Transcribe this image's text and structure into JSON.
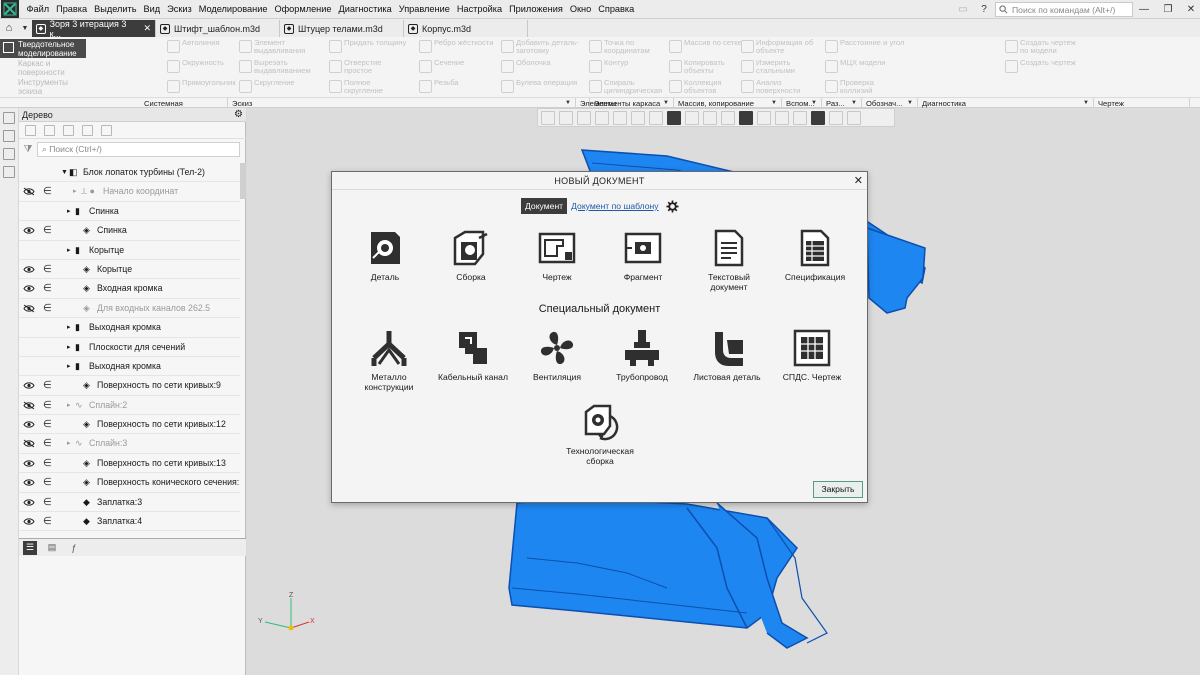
{
  "menu": [
    "Файл",
    "Правка",
    "Выделить",
    "Вид",
    "Эскиз",
    "Моделирование",
    "Оформление",
    "Диагностика",
    "Управление",
    "Настройка",
    "Приложения",
    "Окно",
    "Справка"
  ],
  "search": {
    "placeholder": "Поиск по командам (Alt+/)"
  },
  "tabs": [
    {
      "label": "Зоря 3 итерация 3 к...",
      "active": true
    },
    {
      "label": "Штифт_шаблон.m3d",
      "active": false
    },
    {
      "label": "Штуцер телами.m3d",
      "active": false
    },
    {
      "label": "Корпус.m3d",
      "active": false
    }
  ],
  "ribbon": {
    "modes": [
      "Твердотельное моделирование",
      "Каркас и поверхности",
      "Инструменты эскиза"
    ],
    "tools": [
      "Автолиния",
      "Элемент выдавливания",
      "Придать толщину",
      "Ребро жёсткости",
      "Добавить деталь-заготовку",
      "Точка по координатам",
      "Массив по сетке",
      "Информация об объекте",
      "Расстояние и угол",
      "Создать чертеж по модели",
      "Окружность",
      "Вырезать выдавливанием",
      "Отверстие простое",
      "Сечение",
      "Оболочка",
      "Контур",
      "Копировать объекты",
      "Измерить стальными",
      "МЦХ модели",
      "Создать чертеж",
      "Прямоугольник",
      "Скругление",
      "Полное скругление",
      "Резьба",
      "Булева операция",
      "Спираль цилиндрическая",
      "Коллекция объектов",
      "Анализ поверхности",
      "Проверка коллизий"
    ],
    "groups": [
      {
        "label": "Системная"
      },
      {
        "label": "Эскиз"
      },
      {
        "label": "Элементы тела"
      },
      {
        "label": "Элементы каркаса"
      },
      {
        "label": "Массив, копирование"
      },
      {
        "label": "Вспом..."
      },
      {
        "label": "Раз..."
      },
      {
        "label": "Обознач..."
      },
      {
        "label": "Диагностика"
      },
      {
        "label": "Чертеж"
      }
    ]
  },
  "tree": {
    "title": "Дерево",
    "search_placeholder": "Поиск (Ctrl+/)",
    "rows": [
      {
        "label": "Блок лопаток турбины (Тел-2)",
        "eye": "none",
        "muted": false
      },
      {
        "label": "Начало координат",
        "eye": "hidden",
        "muted": true
      },
      {
        "label": "Спинка",
        "eye": "none",
        "muted": false
      },
      {
        "label": "Спинка",
        "eye": "visible",
        "muted": false
      },
      {
        "label": "Корытце",
        "eye": "none",
        "muted": false
      },
      {
        "label": "Корытце",
        "eye": "visible",
        "muted": false
      },
      {
        "label": "Входная кромка",
        "eye": "visible",
        "muted": false
      },
      {
        "label": "Для входных каналов 262.5",
        "eye": "hidden",
        "muted": true
      },
      {
        "label": "Выходная кромка",
        "eye": "none",
        "muted": false
      },
      {
        "label": "Плоскости для сечений",
        "eye": "none",
        "muted": false
      },
      {
        "label": "Выходная кромка",
        "eye": "none",
        "muted": false
      },
      {
        "label": "Поверхность по сети кривых:9",
        "eye": "visible",
        "muted": false
      },
      {
        "label": "Сплайн:2",
        "eye": "hidden",
        "muted": true
      },
      {
        "label": "Поверхность по сети кривых:12",
        "eye": "visible",
        "muted": false
      },
      {
        "label": "Сплайн:3",
        "eye": "hidden",
        "muted": true
      },
      {
        "label": "Поверхность по сети кривых:13",
        "eye": "visible",
        "muted": false
      },
      {
        "label": "Поверхность конического сечения:",
        "eye": "visible",
        "muted": false
      },
      {
        "label": "Заплатка:3",
        "eye": "visible",
        "muted": false
      },
      {
        "label": "Заплатка:4",
        "eye": "visible",
        "muted": false
      }
    ]
  },
  "dialog": {
    "title": "НОВЫЙ ДОКУМЕНТ",
    "tab_document": "Документ",
    "tab_template": "Документ по шаблону",
    "section_special": "Специальный документ",
    "close_label": "Закрыть",
    "documents": [
      {
        "label": "Деталь",
        "icon": "part-icon"
      },
      {
        "label": "Сборка",
        "icon": "assembly-icon"
      },
      {
        "label": "Чертеж",
        "icon": "drawing-icon"
      },
      {
        "label": "Фрагмент",
        "icon": "fragment-icon"
      },
      {
        "label": "Текстовый документ",
        "icon": "text-document-icon"
      },
      {
        "label": "Спецификация",
        "icon": "specification-icon"
      }
    ],
    "special": [
      {
        "label": "Металло конструкции",
        "icon": "metal-structures-icon"
      },
      {
        "label": "Кабельный канал",
        "icon": "cable-channel-icon"
      },
      {
        "label": "Вентиляция",
        "icon": "ventilation-icon"
      },
      {
        "label": "Трубопровод",
        "icon": "pipeline-icon"
      },
      {
        "label": "Листовая деталь",
        "icon": "sheet-part-icon"
      },
      {
        "label": "СПДС. Чертеж",
        "icon": "spds-drawing-icon"
      },
      {
        "label": "Технологическая сборка",
        "icon": "technological-assembly-icon"
      }
    ]
  },
  "colors": {
    "model_blue": "#1e86f0",
    "model_dark": "#0b4fb0",
    "ui_dark": "#3c3c3c",
    "link_blue": "#1f5aa8"
  },
  "axes": {
    "x": "X",
    "y": "Y",
    "z": "Z"
  }
}
